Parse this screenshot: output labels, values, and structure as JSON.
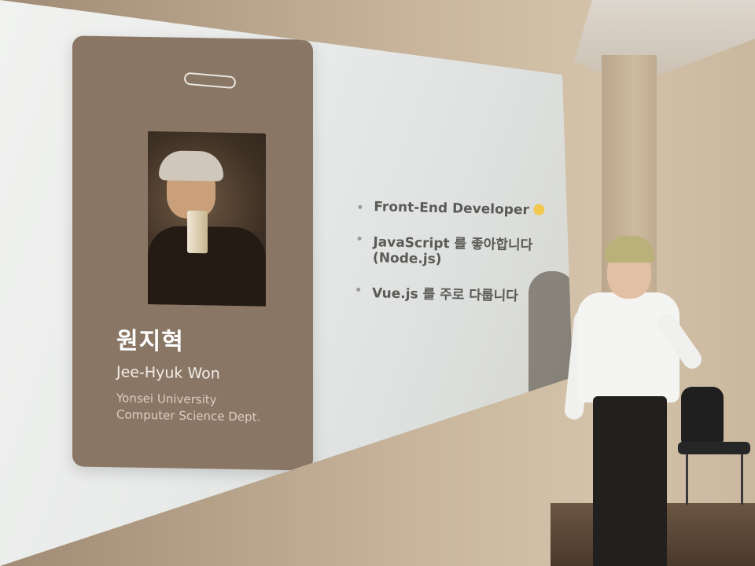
{
  "slide": {
    "card": {
      "name_ko": "원지혁",
      "name_en": "Jee-Hyuk Won",
      "affiliation": [
        "Yonsei University",
        "Computer Science Dept."
      ]
    },
    "bullets": [
      "Front-End Developer",
      "JavaScript 를 좋아합니다 (Node.js)",
      "Vue.js 를 주로 다룹니다"
    ]
  },
  "colors": {
    "card": "#8a7664",
    "screen": "#ecedeb",
    "wall": "#c8b59c"
  },
  "icons": [
    "smiling-emoji-icon"
  ]
}
